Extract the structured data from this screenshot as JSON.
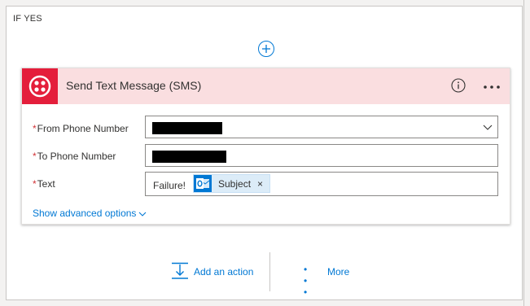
{
  "branch": {
    "title": "IF YES"
  },
  "card": {
    "title": "Send Text Message (SMS)",
    "brand_color": "#e41e3b",
    "header_bg": "#fadee0",
    "icon": "twilio-icon"
  },
  "fields": {
    "from_phone": {
      "required_mark": "*",
      "label": "From Phone Number",
      "value": "[redacted]"
    },
    "to_phone": {
      "required_mark": "*",
      "label": "To Phone Number",
      "value": "[redacted]"
    },
    "text": {
      "required_mark": "*",
      "label": "Text",
      "static_text": "Failure!",
      "token": {
        "label": "Subject",
        "icon": "outlook-icon",
        "remove": "×"
      }
    }
  },
  "advanced": {
    "label": "Show advanced options"
  },
  "actions": {
    "add_action": "Add an action",
    "more_dots": "• • •",
    "more": "More"
  },
  "colors": {
    "accent": "#0078d4",
    "required": "#d13438"
  }
}
